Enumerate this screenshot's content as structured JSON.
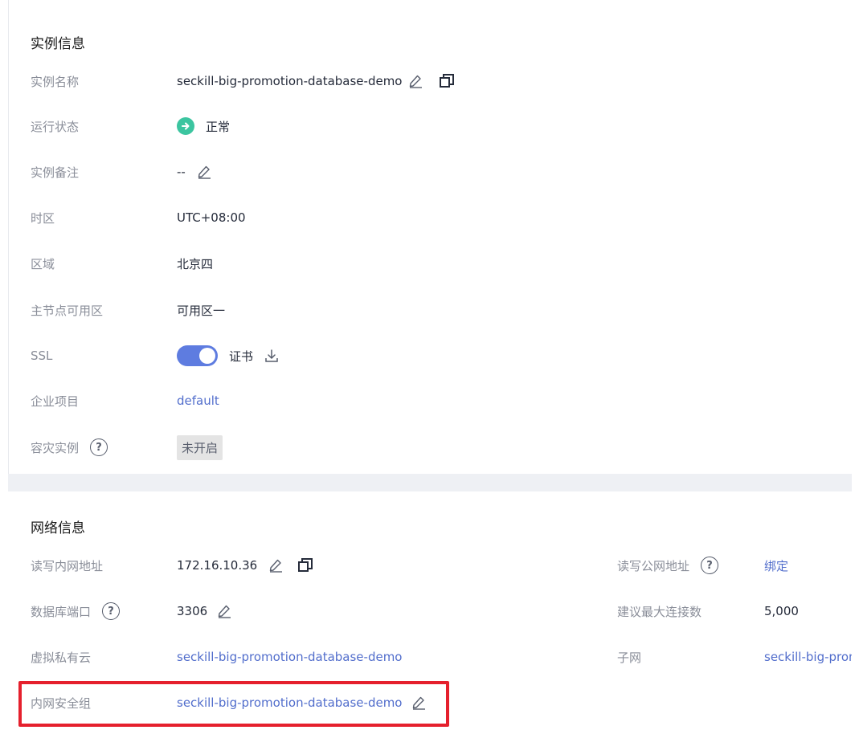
{
  "instance": {
    "title": "实例信息",
    "rows": {
      "name": {
        "label": "实例名称",
        "value": "seckill-big-promotion-database-demo"
      },
      "status": {
        "label": "运行状态",
        "value": "正常"
      },
      "remark": {
        "label": "实例备注",
        "value": "--"
      },
      "timezone": {
        "label": "时区",
        "value": "UTC+08:00"
      },
      "region": {
        "label": "区域",
        "value": "北京四"
      },
      "az": {
        "label": "主节点可用区",
        "value": "可用区一"
      },
      "ssl": {
        "label": "SSL",
        "value": "证书",
        "enabled": true
      },
      "project": {
        "label": "企业项目",
        "value": "default"
      },
      "dr": {
        "label": "容灾实例",
        "value": "未开启"
      }
    }
  },
  "network": {
    "title": "网络信息",
    "rows": {
      "private_ip": {
        "label": "读写内网地址",
        "value": "172.16.10.36"
      },
      "public_ip": {
        "label": "读写公网地址",
        "value": "绑定"
      },
      "port": {
        "label": "数据库端口",
        "value": "3306"
      },
      "max_conn": {
        "label": "建议最大连接数",
        "value": "5,000"
      },
      "vpc": {
        "label": "虚拟私有云",
        "value": "seckill-big-promotion-database-demo"
      },
      "subnet": {
        "label": "子网",
        "value": "seckill-big-promotion-database-demo"
      },
      "security_group": {
        "label": "内网安全组",
        "value": "seckill-big-promotion-database-demo"
      }
    }
  },
  "colors": {
    "accent": "#5e7ce0",
    "link": "#526ecc",
    "status_ok": "#3cc5a0",
    "highlight": "#e5202d"
  },
  "icons": [
    "edit-icon",
    "copy-icon",
    "download-icon",
    "help-icon",
    "status-normal-icon"
  ]
}
